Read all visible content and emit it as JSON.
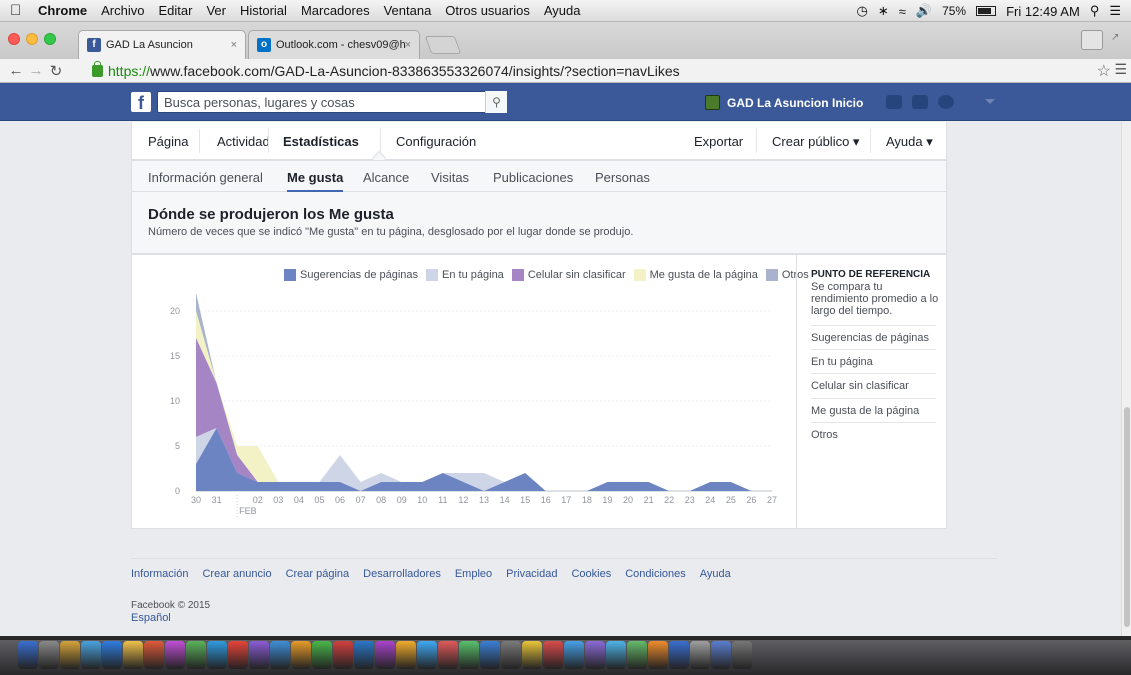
{
  "menubar": {
    "app": "Chrome",
    "items": [
      "Archivo",
      "Editar",
      "Ver",
      "Historial",
      "Marcadores",
      "Ventana",
      "Otros usuarios",
      "Ayuda"
    ],
    "battery": "75%",
    "clock": "Fri 12:49 AM"
  },
  "tabs": [
    {
      "title": "GAD La Asuncion",
      "favicon": "facebook-icon",
      "close": "×"
    },
    {
      "title": "Outlook.com - chesv09@h",
      "favicon": "outlook-icon",
      "close": "×"
    }
  ],
  "address": {
    "scheme": "https://",
    "rest": "www.facebook.com/GAD-La-Asuncion-833863553326074/insights/?section=navLikes"
  },
  "fb": {
    "search_placeholder": "Busca personas, lugares y cosas",
    "page_name": "GAD La Asuncion",
    "home": "Inicio"
  },
  "page_nav": {
    "left": [
      "Página",
      "Actividad",
      "Estadísticas",
      "Configuración"
    ],
    "right": [
      "Exportar",
      "Crear público ▾",
      "Ayuda ▾"
    ],
    "active": "Estadísticas"
  },
  "sub_tabs": {
    "items": [
      "Información general",
      "Me gusta",
      "Alcance",
      "Visitas",
      "Publicaciones",
      "Personas"
    ],
    "active": "Me gusta"
  },
  "section": {
    "title": "Dónde se produjeron los Me gusta",
    "subtitle": "Número de veces que se indicó \"Me gusta\" en tu página, desglosado por el lugar donde se produjo."
  },
  "colors": {
    "sugerencias": "#6d84c2",
    "en_tu_pagina": "#ced5e6",
    "celular": "#a685c4",
    "me_gusta_pagina": "#f3f1c6",
    "otros": "#a9b3cd"
  },
  "chart_data": {
    "type": "area",
    "x": [
      "30",
      "31",
      "01",
      "02",
      "03",
      "04",
      "05",
      "06",
      "07",
      "08",
      "09",
      "10",
      "11",
      "12",
      "13",
      "14",
      "15",
      "16",
      "17",
      "18",
      "19",
      "20",
      "21",
      "22",
      "23",
      "24",
      "25",
      "26",
      "27"
    ],
    "x_tick_labels": [
      "30",
      "31",
      "",
      "02",
      "03",
      "04",
      "05",
      "06",
      "07",
      "08",
      "09",
      "10",
      "11",
      "12",
      "13",
      "14",
      "15",
      "16",
      "17",
      "18",
      "19",
      "20",
      "21",
      "22",
      "23",
      "24",
      "25",
      "26",
      "27"
    ],
    "month_marker": "FEB",
    "ylim": [
      0,
      22
    ],
    "yticks": [
      0,
      5,
      10,
      15,
      20
    ],
    "stacked": true,
    "series": [
      {
        "name": "Sugerencias de páginas",
        "color": "#6d84c2",
        "values": [
          3,
          7,
          2,
          1,
          1,
          1,
          1,
          1,
          0,
          1,
          1,
          1,
          2,
          1,
          0,
          1,
          2,
          0,
          0,
          0,
          1,
          1,
          1,
          0,
          0,
          1,
          1,
          0,
          0
        ]
      },
      {
        "name": "En tu página",
        "color": "#ced5e6",
        "values": [
          3,
          0,
          0,
          0,
          0,
          0,
          0,
          3,
          1,
          1,
          0,
          0,
          0,
          1,
          2,
          0,
          0,
          0,
          0,
          0,
          0,
          0,
          0,
          0,
          0,
          0,
          0,
          0,
          0
        ]
      },
      {
        "name": "Celular sin clasificar",
        "color": "#a685c4",
        "values": [
          11,
          5,
          2,
          0,
          0,
          0,
          0,
          0,
          0,
          0,
          0,
          0,
          0,
          0,
          0,
          0,
          0,
          0,
          0,
          0,
          0,
          0,
          0,
          0,
          0,
          0,
          0,
          0,
          0
        ]
      },
      {
        "name": "Me gusta de la página",
        "color": "#f3f1c6",
        "values": [
          3,
          0,
          1,
          4,
          0,
          0,
          0,
          0,
          0,
          0,
          0,
          0,
          0,
          0,
          0,
          0,
          0,
          0,
          0,
          0,
          0,
          0,
          0,
          0,
          0,
          0,
          0,
          0,
          0
        ]
      },
      {
        "name": "Otros",
        "color": "#a9b3cd",
        "values": [
          2,
          0,
          0,
          0,
          0,
          0,
          0,
          0,
          0,
          0,
          0,
          0,
          0,
          0,
          0,
          0,
          0,
          0,
          0,
          0,
          0,
          0,
          0,
          0,
          0,
          0,
          0,
          0,
          0
        ]
      }
    ]
  },
  "reference": {
    "title": "PUNTO DE REFERENCIA",
    "desc": "Se compara tu rendimiento promedio a lo largo del tiempo.",
    "items": [
      "Sugerencias de páginas",
      "En tu página",
      "Celular sin clasificar",
      "Me gusta de la página",
      "Otros"
    ]
  },
  "footer": {
    "links": [
      "Información",
      "Crear anuncio",
      "Crear página",
      "Desarrolladores",
      "Empleo",
      "Privacidad",
      "Cookies",
      "Condiciones",
      "Ayuda"
    ],
    "copyright": "Facebook © 2015",
    "language": "Español"
  }
}
